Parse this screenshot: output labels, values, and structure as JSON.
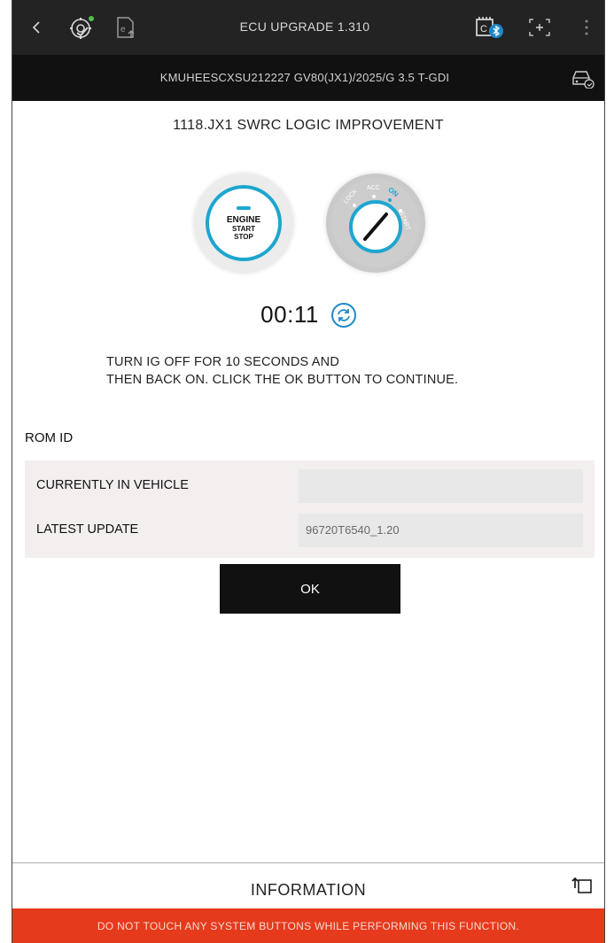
{
  "header": {
    "title": "ECU UPGRADE 1.310",
    "back_icon": "chevron-left-icon",
    "left_icons": [
      "gear-sync-icon",
      "ecu-upload-icon"
    ],
    "right_icons": [
      "bluetooth-vci-icon",
      "screen-capture-icon",
      "more-vert-icon"
    ]
  },
  "vehicle": {
    "info": "KMUHEESCXSU212227  GV80(JX1)/2025/G 3.5 T-GDI",
    "icon": "car-diagnostic-icon"
  },
  "main": {
    "heading": "1118.JX1 SWRC LOGIC IMPROVEMENT",
    "engine_button": {
      "line1": "ENGINE",
      "line2": "START",
      "line3": "STOP"
    },
    "ignition_labels": [
      "LOCK",
      "ACC",
      "ON",
      "START"
    ],
    "timer": "00:11",
    "instruction_line1": "TURN IG OFF FOR 10 SECONDS AND",
    "instruction_line2": "THEN BACK ON. CLICK THE OK BUTTON TO CONTINUE."
  },
  "rom": {
    "title": "ROM ID",
    "rows": [
      {
        "label": "CURRENTLY IN VEHICLE",
        "value": ""
      },
      {
        "label": "LATEST UPDATE",
        "value": "96720T6540_1.20"
      }
    ]
  },
  "ok_label": "OK",
  "footer": {
    "info_label": "INFORMATION",
    "warning": "DO NOT TOUCH ANY SYSTEM BUTTONS WHILE PERFORMING THIS FUNCTION."
  },
  "colors": {
    "accent": "#1ea6cf",
    "warning_bg": "#e53a1c",
    "topbar_bg": "#232323",
    "subbar_bg": "#111111"
  }
}
